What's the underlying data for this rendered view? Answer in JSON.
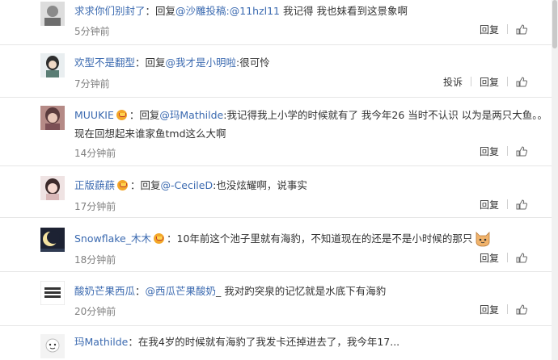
{
  "comments": [
    {
      "username": "求求你们别封了",
      "prefix": "：回复",
      "mention": "@沙雕投稿:@11hzl11",
      "text": " 我记得 我也妹看到这景象啊",
      "time": "5分钟前",
      "actions": [
        "回复"
      ],
      "badge": false
    },
    {
      "username": "欢型不是翻型",
      "prefix": "：回复",
      "mention": "@我才是小明啦",
      "text": ":很可怜",
      "time": "7分钟前",
      "actions": [
        "投诉",
        "回复"
      ],
      "badge": false
    },
    {
      "username": "MUUKIE",
      "prefix": "：回复",
      "mention": "@玛Mathilde",
      "text": ":我记得我上小学的时候就有了 我今年26 当时不认识 以为是两只大鱼。。现在回想起来谁家鱼tmd这么大啊",
      "time": "14分钟前",
      "actions": [
        "回复"
      ],
      "badge": true
    },
    {
      "username": "正版蕻蕻",
      "prefix": "：回复",
      "mention": "@-CecileD",
      "text": ":也没炫耀啊，说事实",
      "time": "17分钟前",
      "actions": [
        "回复"
      ],
      "badge": true
    },
    {
      "username": "Snowflake_木木",
      "prefix": "：",
      "mention": "",
      "text": "10年前这个池子里就有海豹，不知道现在的还是不是小时候的那只",
      "time": "18分钟前",
      "actions": [
        "回复"
      ],
      "badge": true,
      "emoji": "cat-face"
    },
    {
      "username": "酸奶芒果西瓜",
      "prefix": "：",
      "mention": "@西瓜芒果酸奶",
      "text": "_ 我对趵突泉的记忆就是水底下有海豹",
      "time": "20分钟前",
      "actions": [
        "回复"
      ],
      "badge": false
    },
    {
      "username": "玛Mathilde",
      "prefix": "：",
      "mention": "",
      "text": "在我4岁的时候就有海豹了我发卡还掉进去了，我今年17...",
      "time": "",
      "actions": [],
      "badge": false
    }
  ]
}
